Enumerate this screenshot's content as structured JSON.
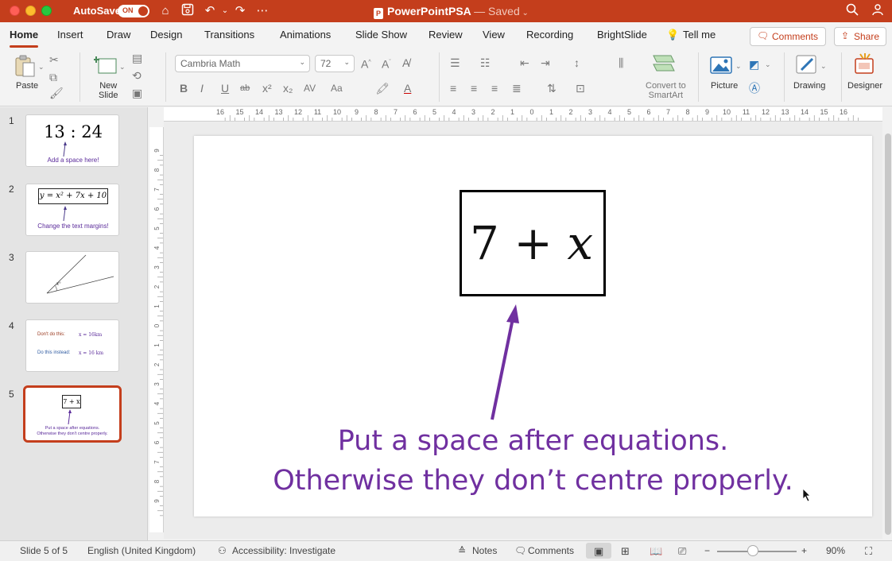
{
  "titlebar": {
    "autosave_label": "AutoSave",
    "autosave_state": "ON",
    "app_title": "PowerPointPSA",
    "saved_status": "— Saved"
  },
  "tabs": [
    "Home",
    "Insert",
    "Draw",
    "Design",
    "Transitions",
    "Animations",
    "Slide Show",
    "Review",
    "View",
    "Recording",
    "BrightSlide"
  ],
  "tell_me": "Tell me",
  "comments_button": "Comments",
  "share_button": "Share",
  "ribbon": {
    "paste": "Paste",
    "new_slide": "New\nSlide",
    "font_name": "Cambria Math",
    "font_size": "72",
    "convert_smartart": "Convert to\nSmartArt",
    "picture": "Picture",
    "drawing": "Drawing",
    "designer": "Designer"
  },
  "thumbnails": [
    {
      "num": "1",
      "title": "13 : 24",
      "caption": "Add a space here!"
    },
    {
      "num": "2",
      "title": "y = x² + 7x + 10",
      "caption": "Change the text margins!"
    },
    {
      "num": "3",
      "label": "x°"
    },
    {
      "num": "4",
      "row1_label": "Don't do this:",
      "row1_value": "x = 16km",
      "row2_label": "Do this instead:",
      "row2_value": "x = 16 km"
    },
    {
      "num": "5",
      "title": "7 + x",
      "caption_line1": "Put a space after equations.",
      "caption_line2": "Otherwise they don't centre properly."
    }
  ],
  "slide": {
    "equation_plain": "7 + ",
    "equation_var": "x",
    "caption_line1": "Put a space after equations.",
    "caption_line2": "Otherwise they don’t centre properly."
  },
  "statusbar": {
    "slide_info": "Slide 5 of 5",
    "language": "English (United Kingdom)",
    "accessibility": "Accessibility: Investigate",
    "notes": "Notes",
    "comments": "Comments",
    "zoom": "90%"
  },
  "colors": {
    "accent": "#c43e1c",
    "caption": "#7030a0"
  }
}
